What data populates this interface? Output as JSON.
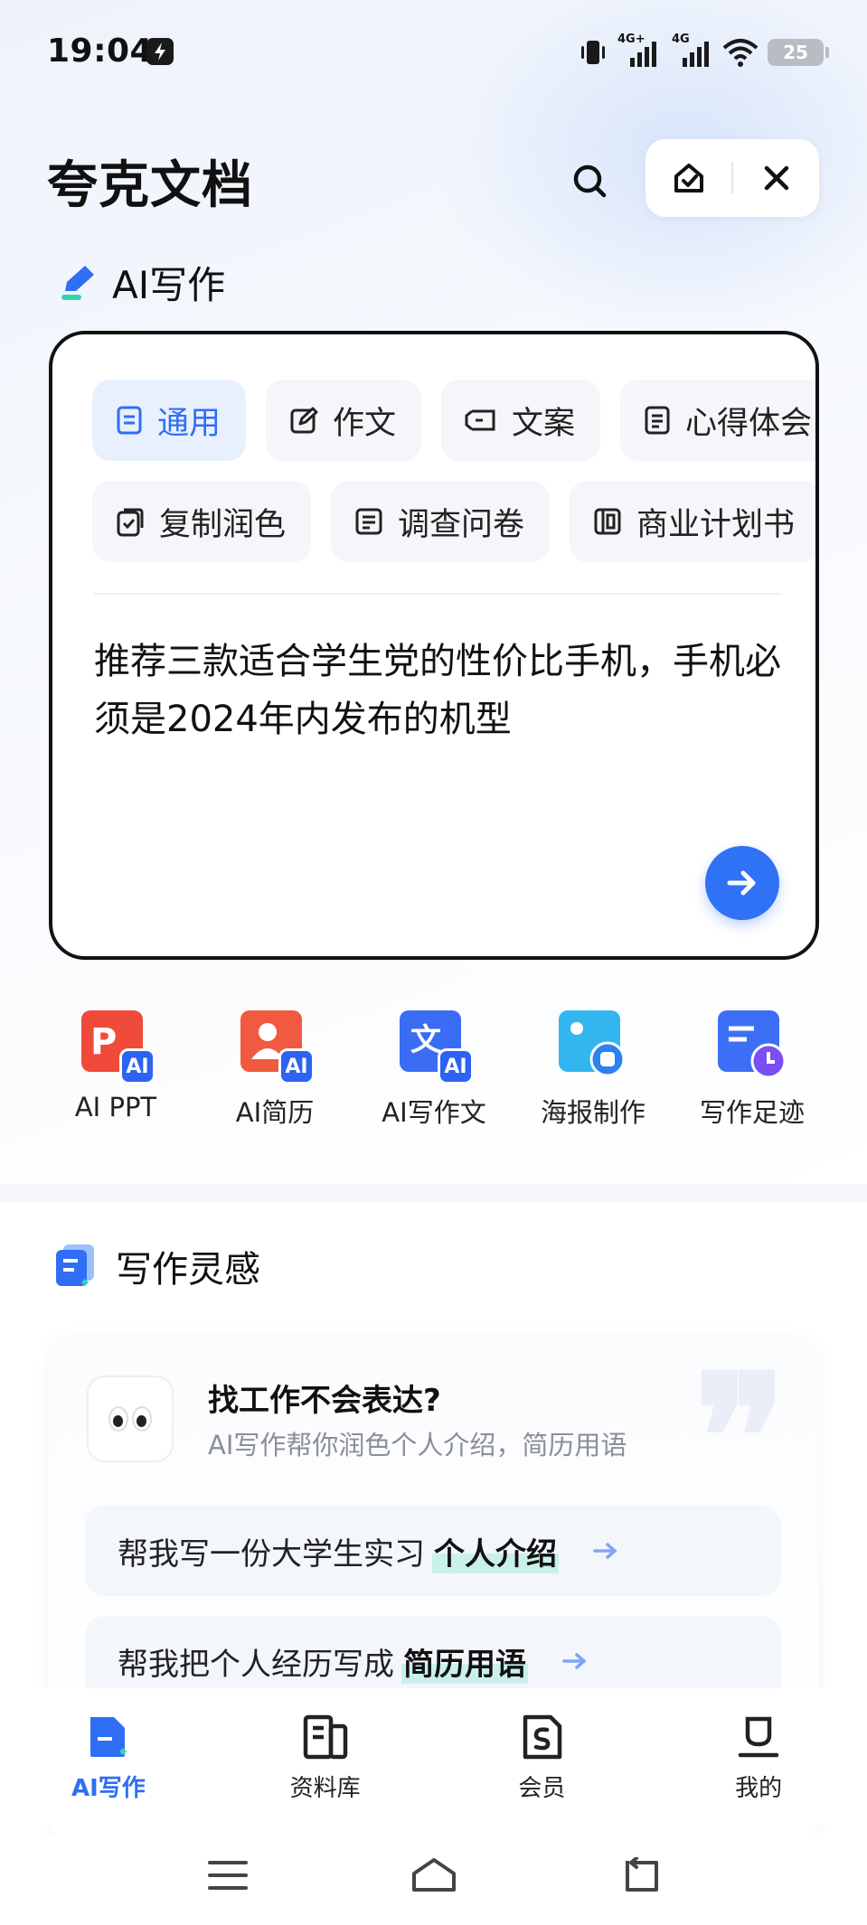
{
  "status_bar": {
    "time": "19:04",
    "network_1": "4G+",
    "network_2": "4G",
    "battery": "25"
  },
  "header": {
    "app_title": "夸克文档"
  },
  "ai_writing": {
    "section_title": "AI写作",
    "chips_row1": [
      "通用",
      "作文",
      "文案",
      "心得体会"
    ],
    "chips_row2": [
      "复制润色",
      "调查问卷",
      "商业计划书"
    ],
    "active_chip": "通用",
    "prompt_text": "推荐三款适合学生党的性价比手机，手机必须是2024年内发布的机型"
  },
  "tools": [
    {
      "label": "AI PPT",
      "icon": "ai-ppt-icon"
    },
    {
      "label": "AI简历",
      "icon": "ai-resume-icon"
    },
    {
      "label": "AI写作文",
      "icon": "ai-essay-icon"
    },
    {
      "label": "海报制作",
      "icon": "poster-icon"
    },
    {
      "label": "写作足迹",
      "icon": "writing-history-icon"
    }
  ],
  "inspiration": {
    "section_title": "写作灵感",
    "card_title": "找工作不会表达?",
    "card_subtitle": "AI写作帮你润色个人介绍，简历用语",
    "suggestions": [
      {
        "prefix": "帮我写一份大学生实习",
        "highlight": "个人介绍"
      },
      {
        "prefix": "帮我把个人经历写成",
        "highlight": "简历用语"
      }
    ]
  },
  "tabbar": [
    {
      "label": "AI写作",
      "active": true
    },
    {
      "label": "资料库",
      "active": false
    },
    {
      "label": "会员",
      "active": false
    },
    {
      "label": "我的",
      "active": false
    }
  ],
  "colors": {
    "accent": "#2f6ef5",
    "highlight": "#c9f1ea"
  }
}
